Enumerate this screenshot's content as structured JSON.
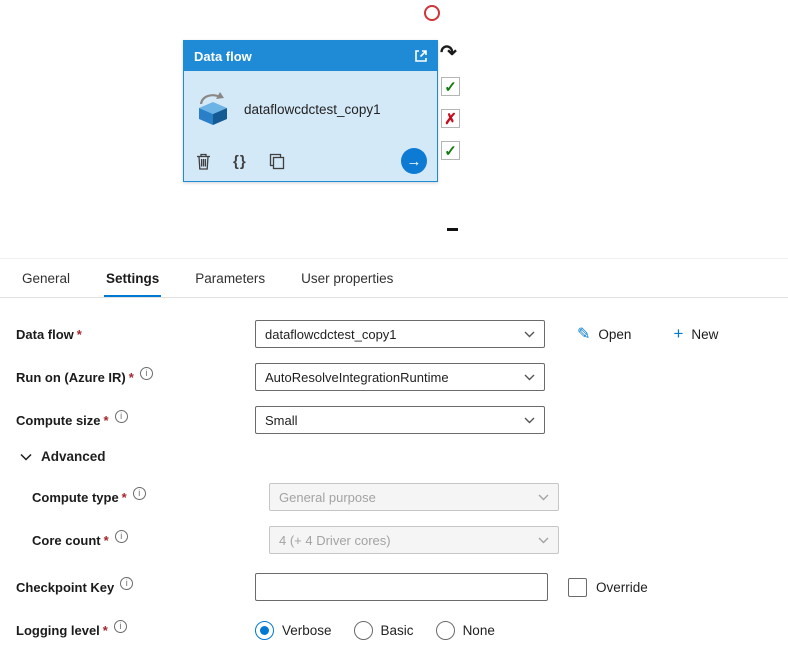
{
  "canvas": {
    "card": {
      "header_title": "Data flow",
      "name": "dataflowcdctest_copy1"
    }
  },
  "tabs": {
    "items": [
      {
        "label": "General"
      },
      {
        "label": "Settings"
      },
      {
        "label": "Parameters"
      },
      {
        "label": "User properties"
      }
    ],
    "selected": "Settings"
  },
  "form": {
    "required_marker": "*",
    "info_glyph": "i",
    "data_flow": {
      "label": "Data flow",
      "value": "dataflowcdctest_copy1",
      "open_label": "Open",
      "new_label": "New"
    },
    "run_on": {
      "label": "Run on (Azure IR)",
      "value": "AutoResolveIntegrationRuntime"
    },
    "compute_size": {
      "label": "Compute size",
      "value": "Small"
    },
    "advanced": {
      "label": "Advanced",
      "expanded": true
    },
    "compute_type": {
      "label": "Compute type",
      "value": "General purpose",
      "disabled": true
    },
    "core_count": {
      "label": "Core count",
      "value": "4 (+ 4 Driver cores)",
      "disabled": true
    },
    "checkpoint_key": {
      "label": "Checkpoint Key",
      "value": "",
      "override_label": "Override",
      "override_checked": false
    },
    "logging_level": {
      "label": "Logging level",
      "options": [
        "Verbose",
        "Basic",
        "None"
      ],
      "selected": "Verbose"
    }
  },
  "icons": {
    "braces": "{}",
    "arrow_right": "→",
    "redo": "↷",
    "check": "✓",
    "cross": "✗",
    "pencil": "✎",
    "plus": "+"
  },
  "colors": {
    "accent": "#0078d4",
    "card_header": "#1f8ad6",
    "card_body": "#d4e9f8",
    "required": "#a4262c",
    "check_green": "#107c10",
    "cross_red": "#c50f1f"
  }
}
